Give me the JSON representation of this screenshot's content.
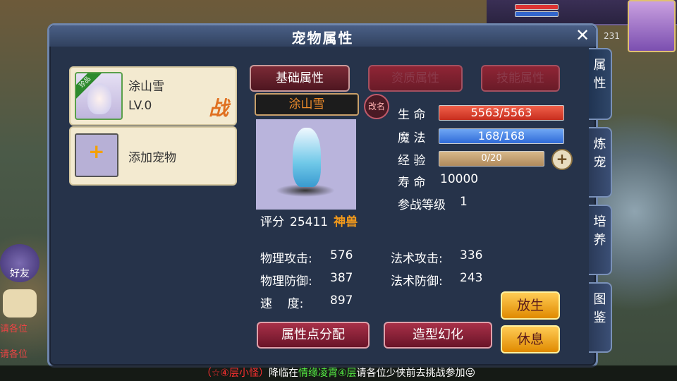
{
  "dialog": {
    "title": "宠物属性"
  },
  "pet_list": [
    {
      "name": "涂山雪",
      "level": "LV.0",
      "badge": "战",
      "tag": "珍品"
    },
    {
      "add_label": "添加宠物"
    }
  ],
  "tabs": [
    "基础属性",
    "资质属性",
    "技能属性"
  ],
  "pet": {
    "name": "涂山雪",
    "rename": "改名",
    "score_label": "评分",
    "score": "25411",
    "rank": "神兽"
  },
  "vitals": {
    "hp_label": "生 命",
    "hp": "5563/5563",
    "mp_label": "魔 法",
    "mp": "168/168",
    "xp_label": "经 验",
    "xp": "0/20",
    "life_label": "寿 命",
    "life": "10000",
    "battle_level_label": "参战等级",
    "battle_level": "1"
  },
  "stats": {
    "phys_atk_label": "物理攻击:",
    "phys_atk": "576",
    "mag_atk_label": "法术攻击:",
    "mag_atk": "336",
    "phys_def_label": "物理防御:",
    "phys_def": "387",
    "mag_def_label": "法术防御:",
    "mag_def": "243",
    "speed_label": "速    度:",
    "speed": "897"
  },
  "buttons": {
    "allocate": "属性点分配",
    "morph": "造型幻化",
    "release": "放生",
    "rest": "休息"
  },
  "side_tabs": [
    "属性",
    "炼宠",
    "培养",
    "图鉴"
  ],
  "hud": {
    "number": "231",
    "friend": "好友",
    "chat_lines": [
      "请各位",
      "请各位"
    ]
  },
  "ticker": {
    "part1": "（☆④层小怪）",
    "part2": "降临在",
    "part3": "情缘凌霄④层",
    "part4": "请各位少侠前去挑战参加😜"
  },
  "colors": {
    "panel": "#26334a",
    "accent_red": "#8f2535",
    "gold": "#f49a1a"
  }
}
